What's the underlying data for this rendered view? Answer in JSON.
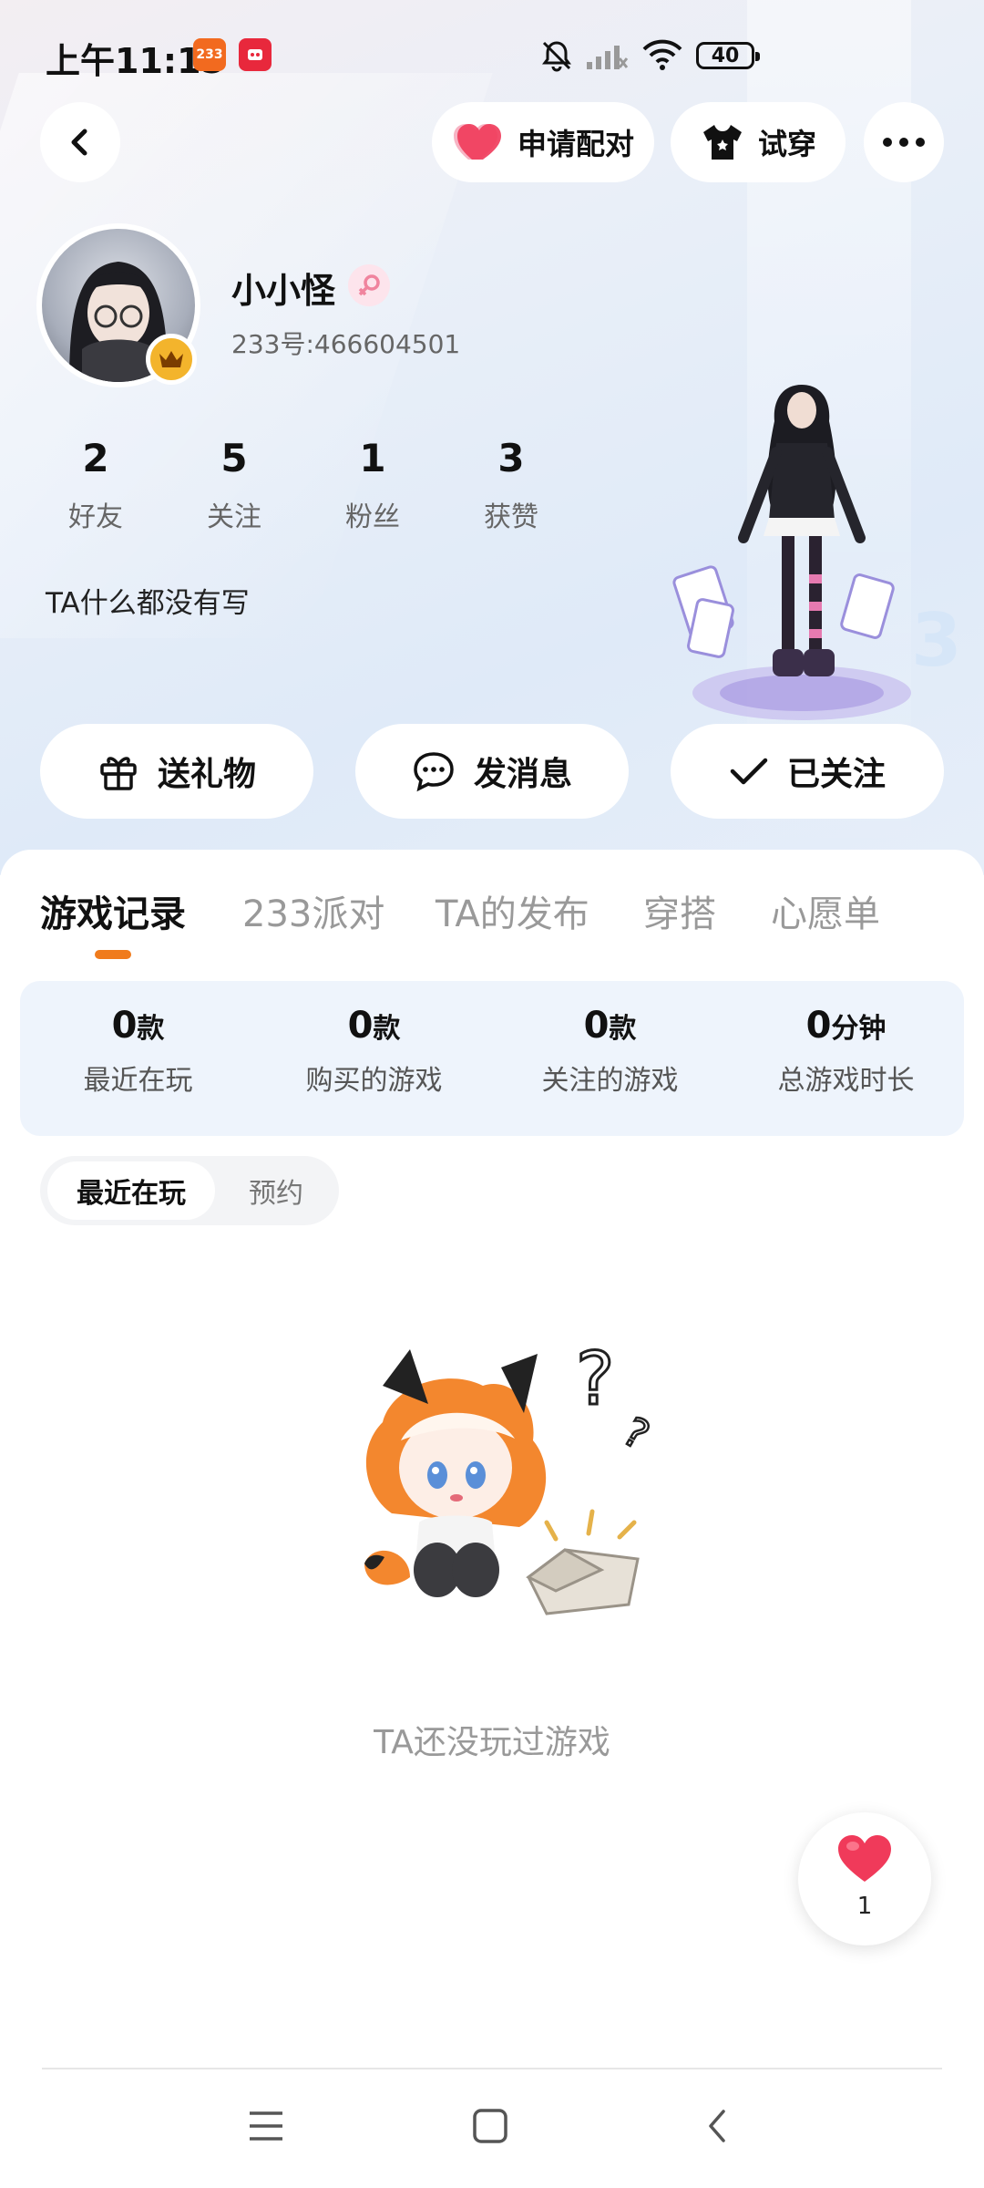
{
  "status_bar": {
    "time": "上午11:15",
    "app_badges": [
      "233",
      "app-icon"
    ],
    "battery": "40"
  },
  "header": {
    "back_icon": "back-arrow-icon",
    "pair_label": "申请配对",
    "tryon_label": "试穿",
    "more_icon": "more-dots-icon"
  },
  "profile": {
    "name": "小小怪",
    "gender_icon": "female-icon",
    "uid": "233号:466604501",
    "stats": [
      {
        "value": "2",
        "label": "好友"
      },
      {
        "value": "5",
        "label": "关注"
      },
      {
        "value": "1",
        "label": "粉丝"
      },
      {
        "value": "3",
        "label": "获赞"
      }
    ],
    "bio": "TA什么都没有写"
  },
  "actions": {
    "gift": "送礼物",
    "message": "发消息",
    "followed": "已关注"
  },
  "tabs": [
    {
      "label": "游戏记录",
      "active": true
    },
    {
      "label": "233派对",
      "active": false
    },
    {
      "label": "TA的发布",
      "active": false
    },
    {
      "label": "穿搭",
      "active": false
    },
    {
      "label": "心愿单",
      "active": false
    }
  ],
  "game_stats": [
    {
      "value": "0",
      "unit": "款",
      "label": "最近在玩"
    },
    {
      "value": "0",
      "unit": "款",
      "label": "购买的游戏"
    },
    {
      "value": "0",
      "unit": "款",
      "label": "关注的游戏"
    },
    {
      "value": "0",
      "unit": "分钟",
      "label": "总游戏时长"
    }
  ],
  "segments": {
    "recent": "最近在玩",
    "reserve": "预约"
  },
  "empty": {
    "text": "TA还没玩过游戏"
  },
  "like": {
    "count": "1"
  },
  "colors": {
    "accent": "#f07b1c",
    "heart": "#f03a5a",
    "crown": "#f3b42c"
  }
}
